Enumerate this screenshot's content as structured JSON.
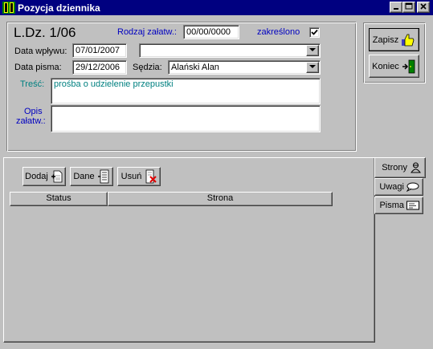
{
  "window": {
    "title": "Pozycja dziennika",
    "icon": "app-icon"
  },
  "header": {
    "ldz_label": "L.Dz. 1/06",
    "rodzaj_label": "Rodzaj załatw.:",
    "rodzaj_value": "00/00/0000",
    "zakreslono_label": "zakreślono",
    "zakreslono_checked": true,
    "data_wplywu_label": "Data wpływu:",
    "data_wplywu_value": "07/01/2007",
    "combo_top_value": "",
    "data_pisma_label": "Data pisma:",
    "data_pisma_value": "29/12/2006",
    "sedzia_label": "Sędzia:",
    "sedzia_value": "Alański Alan",
    "tresc_label": "Treść:",
    "tresc_value": "prośba o udzielenie przepustki",
    "opis_label_line1": "Opis",
    "opis_label_line2": "załatw.:",
    "opis_value": ""
  },
  "side_buttons": {
    "save_label": "Zapisz",
    "end_label": "Koniec"
  },
  "toolbar": {
    "add_label": "Dodaj",
    "data_label": "Dane",
    "delete_label": "Usuń"
  },
  "table": {
    "columns": [
      "Status",
      "Strona"
    ],
    "rows": []
  },
  "tabs": [
    {
      "label": "Strony",
      "icon": "people-icon",
      "active": true
    },
    {
      "label": "Uwagi",
      "icon": "speech-bubble-icon",
      "active": false
    },
    {
      "label": "Pisma",
      "icon": "letter-icon",
      "active": false
    }
  ],
  "colors": {
    "titlebar": "#000080",
    "face": "#c0c0c0",
    "label_blue": "#0000c0",
    "tresc_teal": "#008080"
  }
}
